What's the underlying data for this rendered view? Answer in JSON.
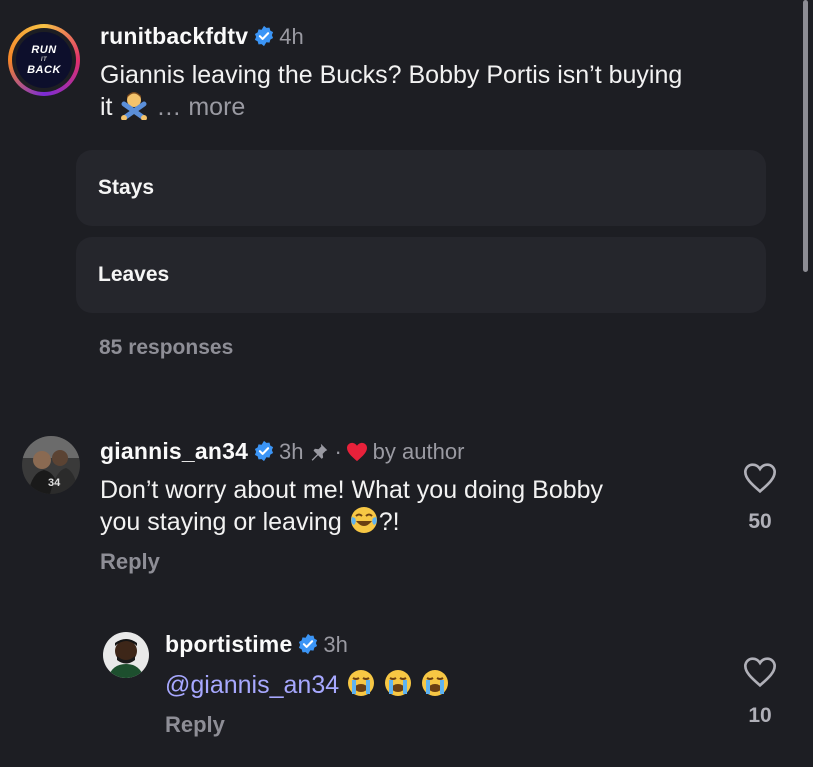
{
  "post": {
    "avatar_logo": {
      "line1": "RUN",
      "line2": "IT",
      "line3": "BACK"
    },
    "username": "runitbackfdtv",
    "time": "4h",
    "caption": "Giannis leaving the Bucks? Bobby Portis isn’t buying",
    "caption_line2": "it",
    "caption_emoji": "person-gesturing-no",
    "more": "… more"
  },
  "poll": {
    "options": [
      {
        "label": "Stays"
      },
      {
        "label": "Leaves"
      }
    ],
    "responses": "85 responses"
  },
  "comments": [
    {
      "username": "giannis_an34",
      "time": "3h",
      "pinned_icon": "pin-icon",
      "separator": "·",
      "liked_by_author": "by author",
      "text_line1": "Don’t worry about me! What you doing Bobby",
      "text_line2": "you staying or leaving",
      "text_emoji": "face-with-tears-of-joy",
      "text_suffix": "?!",
      "reply": "Reply",
      "likes": "50"
    },
    {
      "username": "bportistime",
      "time": "3h",
      "mention": "@giannis_an34",
      "emojis": [
        "loudly-crying-face",
        "loudly-crying-face",
        "loudly-crying-face"
      ],
      "reply": "Reply",
      "likes": "10"
    }
  ],
  "colors": {
    "background": "#1d1e23",
    "poll_option": "#25262c",
    "verified": "#3b95f6",
    "heart_author": "#e8213a",
    "mention": "#a7a8ff",
    "muted": "#8e8e96"
  }
}
